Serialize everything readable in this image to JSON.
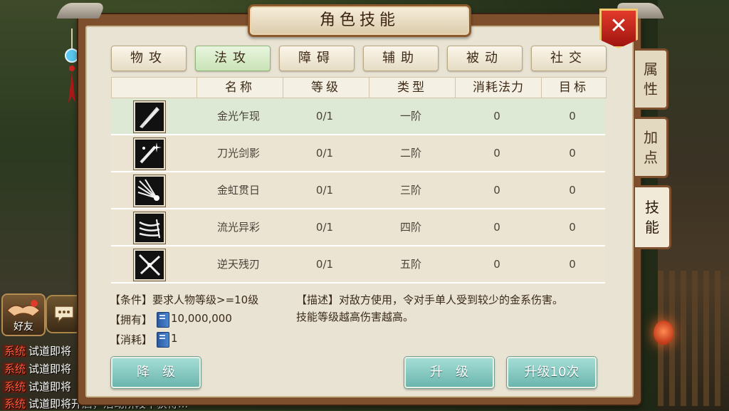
{
  "window": {
    "title": "角色技能",
    "close_symbol": "✕"
  },
  "category_tabs": [
    {
      "label": "物攻",
      "active": false
    },
    {
      "label": "法攻",
      "active": true
    },
    {
      "label": "障碍",
      "active": false
    },
    {
      "label": "辅助",
      "active": false
    },
    {
      "label": "被动",
      "active": false
    },
    {
      "label": "社交",
      "active": false
    }
  ],
  "side_tabs": [
    {
      "label": [
        "属",
        "性"
      ],
      "active": false
    },
    {
      "label": [
        "加",
        "点"
      ],
      "active": false
    },
    {
      "label": [
        "技",
        "能"
      ],
      "active": true
    }
  ],
  "table": {
    "headers": [
      "",
      "名称",
      "等级",
      "类型",
      "消耗法力",
      "目标"
    ],
    "rows": [
      {
        "icon": "spear-strike-icon",
        "name": "金光乍现",
        "level": "0/1",
        "type": "一阶",
        "mana": "0",
        "target": "0",
        "selected": true
      },
      {
        "icon": "sparkle-blade-icon",
        "name": "刀光剑影",
        "level": "0/1",
        "type": "二阶",
        "mana": "0",
        "target": "0",
        "selected": false
      },
      {
        "icon": "sun-blades-icon",
        "name": "金虹贯日",
        "level": "0/1",
        "type": "三阶",
        "mana": "0",
        "target": "0",
        "selected": false
      },
      {
        "icon": "trident-flow-icon",
        "name": "流光异彩",
        "level": "0/1",
        "type": "四阶",
        "mana": "0",
        "target": "0",
        "selected": false
      },
      {
        "icon": "cross-blades-icon",
        "name": "逆天残刃",
        "level": "0/1",
        "type": "五阶",
        "mana": "0",
        "target": "0",
        "selected": false
      }
    ]
  },
  "info": {
    "condition": "【条件】要求人物等级>=10级",
    "owned_label": "【拥有】",
    "owned_value": "10,000,000",
    "cost_label": "【消耗】",
    "cost_value": "1",
    "description_line1": "【描述】对敌方使用，令对手单人受到较少的金系伤害。",
    "description_line2": "技能等级越高伤害越高。"
  },
  "buttons": {
    "downgrade": "降　级",
    "upgrade": "升　级",
    "upgrade10": "升级10次"
  },
  "background": {
    "friend_label": "好友",
    "chat_tag": "系统",
    "chat_lines": [
      "试道即将",
      "试道即将",
      "试道即将",
      "试道即将开启，活动阶段中获得..."
    ]
  }
}
